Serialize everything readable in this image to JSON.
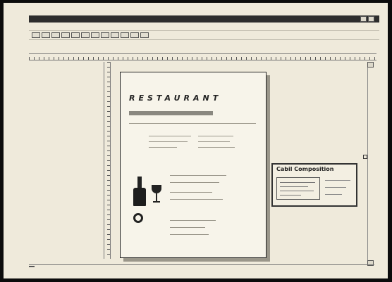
{
  "window": {
    "title": ""
  },
  "doc": {
    "heading_line1": "",
    "heading_line2": "RESTAURANT"
  },
  "dialog": {
    "title": "Cabil Composition"
  }
}
